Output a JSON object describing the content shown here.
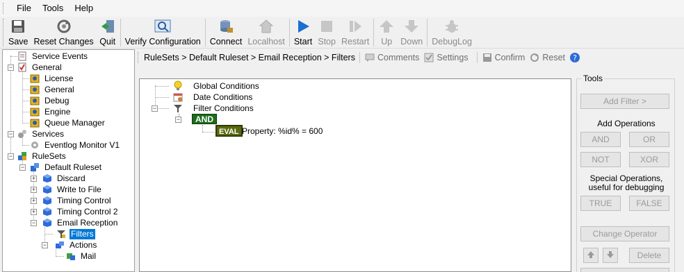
{
  "menu": {
    "items": [
      "File",
      "Tools",
      "Help"
    ]
  },
  "toolbar": {
    "save": "Save",
    "reset_changes": "Reset Changes",
    "quit": "Quit",
    "verify": "Verify Configuration",
    "connect": "Connect",
    "localhost": "Localhost",
    "start": "Start",
    "stop": "Stop",
    "restart": "Restart",
    "up": "Up",
    "down": "Down",
    "debuglog": "DebugLog"
  },
  "tree": {
    "service_events": "Service Events",
    "general": "General",
    "license": "License",
    "general_child": "General",
    "debug": "Debug",
    "engine": "Engine",
    "queue_manager": "Queue Manager",
    "services": "Services",
    "eventlog_monitor": "Eventlog Monitor V1",
    "rulesets": "RuleSets",
    "default_ruleset": "Default Ruleset",
    "discard": "Discard",
    "write_to_file": "Write to File",
    "timing_control": "Timing Control",
    "timing_control_2": "Timing Control 2",
    "email_reception": "Email Reception",
    "filters": "Filters",
    "actions": "Actions",
    "mail": "Mail"
  },
  "breadcrumb": {
    "path": "RuleSets > Default Ruleset > Email Reception > Filters",
    "comments": "Comments",
    "settings": "Settings",
    "confirm": "Confirm",
    "reset": "Reset"
  },
  "filter_tree": {
    "global_conditions": "Global Conditions",
    "date_conditions": "Date Conditions",
    "filter_conditions": "Filter Conditions",
    "and_op": "AND",
    "eval_op": "EVAL",
    "property_expr": "Property: %id% = 600"
  },
  "tools": {
    "title": "Tools",
    "add_filter": "Add Filter >",
    "add_operations": "Add Operations",
    "and": "AND",
    "or": "OR",
    "not": "NOT",
    "xor": "XOR",
    "special_line1": "Special Operations,",
    "special_line2": "useful for debugging",
    "true": "TRUE",
    "false": "FALSE",
    "change_operator": "Change Operator",
    "delete": "Delete"
  },
  "colors": {
    "selection": "#0078d7",
    "op_green": "#1e6b1e",
    "eval_olive": "#5a6a10"
  }
}
